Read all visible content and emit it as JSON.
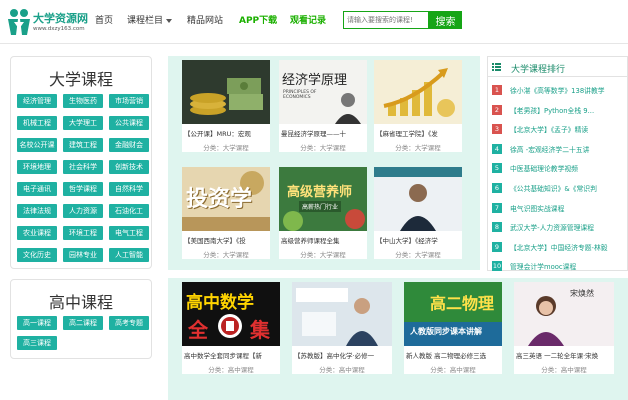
{
  "header": {
    "logo_text": "大学资源网",
    "logo_url": "www.dxzy163.com",
    "nav": {
      "home": "首页",
      "category": "课程栏目",
      "featured": "精品网站",
      "app": "APP下载",
      "watch_history": "观看记录"
    },
    "search": {
      "placeholder": "请输入要搜索的课程!",
      "button": "搜索"
    }
  },
  "colors": {
    "brand": "#1aa089",
    "tag_bg": "#1fb1a2",
    "green": "#16a516",
    "rank_red": "#d9534f",
    "rank_teal": "#1fb1a2"
  },
  "university": {
    "title": "大学课程",
    "tags": [
      "经济管理",
      "生物医药",
      "市场营销",
      "机械工程",
      "大学理工",
      "公共课程",
      "名校公开课",
      "建筑工程",
      "金融财会",
      "环境地理",
      "社会科学",
      "创新技术",
      "电子通讯",
      "哲学课程",
      "自然科学",
      "法律法规",
      "人力资源",
      "石油化工",
      "农业课程",
      "环境工程",
      "电气工程",
      "文化历史",
      "园林专业",
      "人工智能"
    ]
  },
  "highschool": {
    "title": "高中课程",
    "tags": [
      "高一课程",
      "高二课程",
      "高考专题",
      "高三课程"
    ]
  },
  "courses": [
    {
      "title": "【公开课】MRU：宏观",
      "category": "分类：大学课程"
    },
    {
      "title": "曼昆经济学原理——十",
      "category": "分类：大学课程"
    },
    {
      "title": "【麻省理工学院】《发",
      "category": "分类：大学课程"
    },
    {
      "title": "【美国西南大学】《投",
      "category": "分类：大学课程"
    },
    {
      "title": "高级营养师课程全集",
      "category": "分类：大学课程"
    },
    {
      "title": "【中山大学】《经济学",
      "category": "分类：大学课程"
    }
  ],
  "thumbs": {
    "econ_title": "经济学原理",
    "econ_en": "PRINCIPLES OF ECONOMICS",
    "invest": "投资学",
    "nutrition": "高级营养师",
    "nutrition_sub": "高薪热门行业",
    "math_main": "高中数学",
    "math_sub": "全",
    "math_end": "集",
    "physics_main": "高二物理",
    "physics_sub": "人教版同步课本讲解",
    "english_name": "宋焕然"
  },
  "courses2": [
    {
      "title": "高中数学全套同步课程【新",
      "category": "分类：高中课程"
    },
    {
      "title": "【苏教版】高中化学·必修一",
      "category": "分类：高中课程"
    },
    {
      "title": "新人教版 高二物理必修三选",
      "category": "分类：高中课程"
    },
    {
      "title": "高三英语 一二轮全年课·宋焕",
      "category": "分类：高中课程"
    }
  ],
  "ranking": {
    "title": "大学课程排行",
    "items": [
      {
        "n": "1",
        "text": "徐小湛《高等数学》138讲教学"
      },
      {
        "n": "2",
        "text": "【老男孩】Python全栈 9..."
      },
      {
        "n": "3",
        "text": "【北京大学】《孟子》精读"
      },
      {
        "n": "4",
        "text": "徐高 -宏观经济学二十五讲"
      },
      {
        "n": "5",
        "text": "中医基础理论教学视频"
      },
      {
        "n": "6",
        "text": "《公共基础知识》&《常识判"
      },
      {
        "n": "7",
        "text": "电气识图实战课程"
      },
      {
        "n": "8",
        "text": "武汉大学-人力资源管理课程"
      },
      {
        "n": "9",
        "text": "【北京大学】中国经济专题-林毅"
      },
      {
        "n": "10",
        "text": "管理会计学mooc课程"
      }
    ]
  }
}
